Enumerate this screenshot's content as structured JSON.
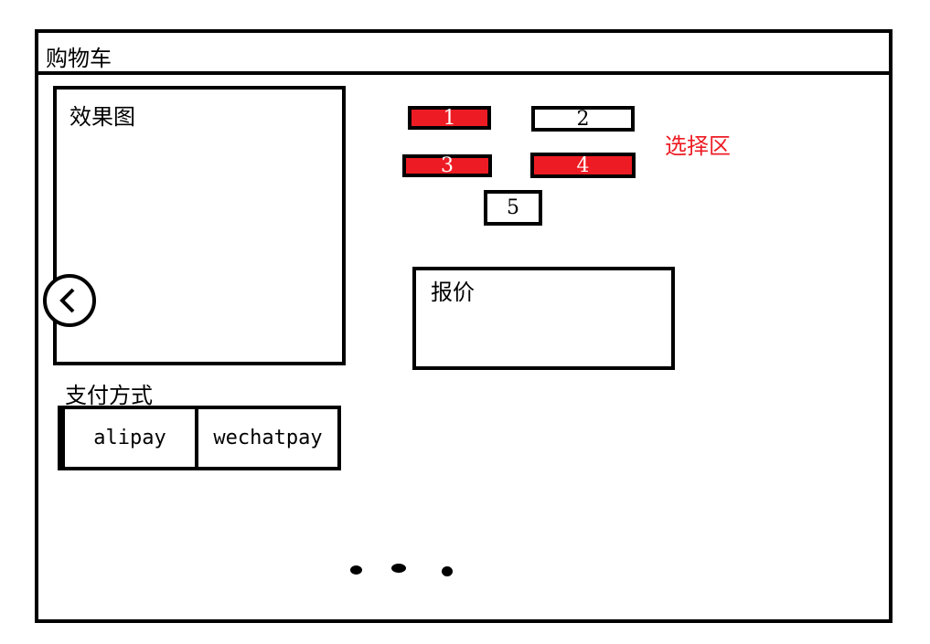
{
  "window": {
    "title": "购物车"
  },
  "preview": {
    "label": "效果图",
    "back_icon": "chevron-left-icon"
  },
  "selection": {
    "label": "选择区",
    "label_color": "#ed1c24",
    "selected_color": "#ed1c24",
    "options": [
      {
        "label": "1",
        "selected": true
      },
      {
        "label": "2",
        "selected": false
      },
      {
        "label": "3",
        "selected": true
      },
      {
        "label": "4",
        "selected": true
      },
      {
        "label": "5",
        "selected": false
      }
    ]
  },
  "quote": {
    "label": "报价"
  },
  "payment": {
    "label": "支付方式",
    "methods": [
      "alipay",
      "wechatpay"
    ]
  },
  "pagination": {
    "dots": 3
  }
}
